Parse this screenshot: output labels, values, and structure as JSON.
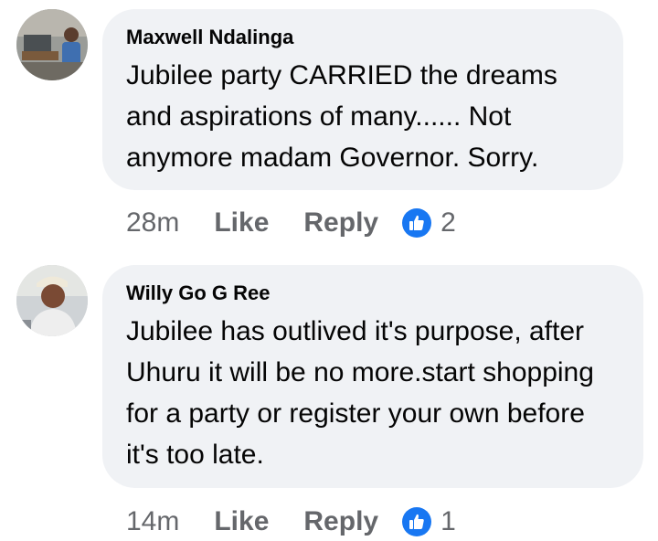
{
  "comments": [
    {
      "author": "Maxwell Ndalinga",
      "text": "Jubilee party CARRIED the dreams and aspirations of many...... Not anymore madam Governor. Sorry.",
      "time": "28m",
      "like_label": "Like",
      "reply_label": "Reply",
      "reaction_count": "2"
    },
    {
      "author": "Willy Go G Ree",
      "text": "Jubilee has outlived it's purpose, after Uhuru it will be no more.start shopping for a party or register your own before it's too late.",
      "time": "14m",
      "like_label": "Like",
      "reply_label": "Reply",
      "reaction_count": "1"
    }
  ],
  "colors": {
    "bubble_bg": "#f0f2f5",
    "meta_text": "#65676b",
    "like_blue": "#1877f2"
  },
  "icons": {
    "reaction": "thumbs-up-icon"
  }
}
